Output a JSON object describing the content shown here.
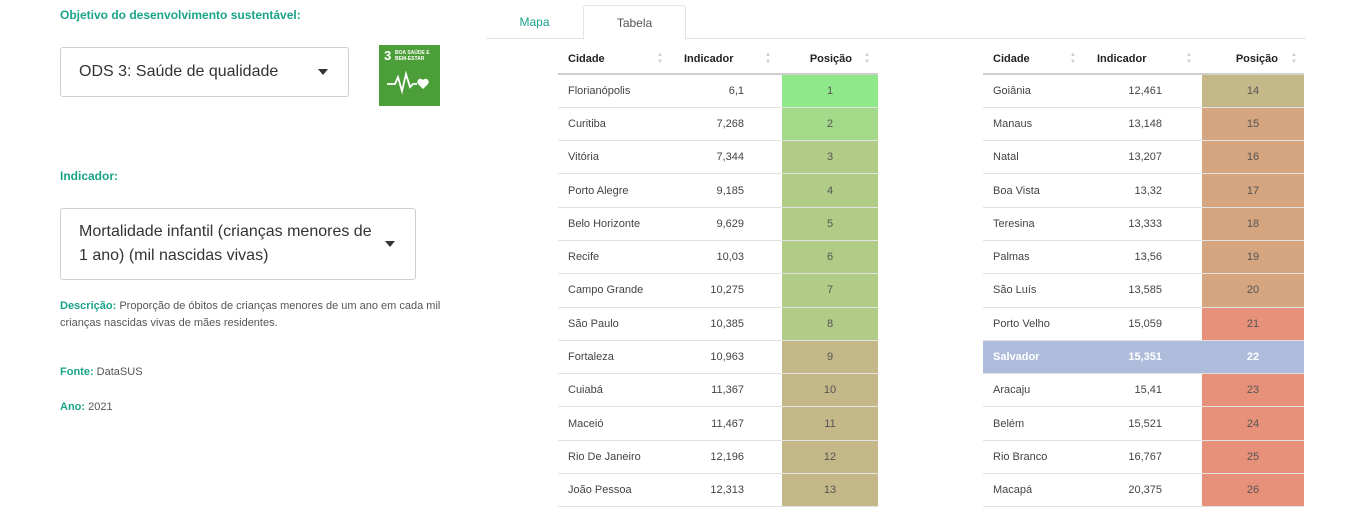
{
  "filters": {
    "ods_label": "Objetivo do desenvolvimento sustentável:",
    "ods_value": "ODS 3: Saúde de qualidade",
    "indicator_label": "Indicador:",
    "indicator_value": "Mortalidade infantil (crianças menores de 1 ano) (mil nascidas vivas)"
  },
  "sdg_logo": {
    "number": "3",
    "text": "BOA SAÚDE E BEM-ESTAR",
    "color": "#4c9f38",
    "icon": "heartbeat-icon"
  },
  "info": {
    "description_label": "Descrição:",
    "description": "Proporção de óbitos de crianças menores de um ano em cada mil crianças nascidas vivas de mães residentes.",
    "source_label": "Fonte:",
    "source": "DataSUS",
    "year_label": "Ano:",
    "year": "2021"
  },
  "tabs": {
    "map": "Mapa",
    "table": "Tabela",
    "active": "Tabela"
  },
  "columns": {
    "city": "Cidade",
    "indicator": "Indicador",
    "position": "Posição"
  },
  "highlight_color": "#aebcdc",
  "rows_left": [
    {
      "city": "Florianópolis",
      "indicator": "6,1",
      "position": "1",
      "color": "#8fe98a"
    },
    {
      "city": "Curitiba",
      "indicator": "7,268",
      "position": "2",
      "color": "#a3da8a"
    },
    {
      "city": "Vitória",
      "indicator": "7,344",
      "position": "3",
      "color": "#b0cc87"
    },
    {
      "city": "Porto Alegre",
      "indicator": "9,185",
      "position": "4",
      "color": "#b0cc87"
    },
    {
      "city": "Belo Horizonte",
      "indicator": "9,629",
      "position": "5",
      "color": "#b0cc87"
    },
    {
      "city": "Recife",
      "indicator": "10,03",
      "position": "6",
      "color": "#b0cc87"
    },
    {
      "city": "Campo Grande",
      "indicator": "10,275",
      "position": "7",
      "color": "#b0cc87"
    },
    {
      "city": "São Paulo",
      "indicator": "10,385",
      "position": "8",
      "color": "#b0cc87"
    },
    {
      "city": "Fortaleza",
      "indicator": "10,963",
      "position": "9",
      "color": "#c4b888"
    },
    {
      "city": "Cuiabá",
      "indicator": "11,367",
      "position": "10",
      "color": "#c4b888"
    },
    {
      "city": "Maceió",
      "indicator": "11,467",
      "position": "11",
      "color": "#c4b888"
    },
    {
      "city": "Rio De Janeiro",
      "indicator": "12,196",
      "position": "12",
      "color": "#c4b888"
    },
    {
      "city": "João Pessoa",
      "indicator": "12,313",
      "position": "13",
      "color": "#c4b888"
    }
  ],
  "rows_right": [
    {
      "city": "Goiânia",
      "indicator": "12,461",
      "position": "14",
      "color": "#c4b888"
    },
    {
      "city": "Manaus",
      "indicator": "13,148",
      "position": "15",
      "color": "#d4a57e"
    },
    {
      "city": "Natal",
      "indicator": "13,207",
      "position": "16",
      "color": "#d4a57e"
    },
    {
      "city": "Boa Vista",
      "indicator": "13,32",
      "position": "17",
      "color": "#d4a57e"
    },
    {
      "city": "Teresina",
      "indicator": "13,333",
      "position": "18",
      "color": "#d4a57e"
    },
    {
      "city": "Palmas",
      "indicator": "13,56",
      "position": "19",
      "color": "#d4a57e"
    },
    {
      "city": "São Luís",
      "indicator": "13,585",
      "position": "20",
      "color": "#d4a57e"
    },
    {
      "city": "Porto Velho",
      "indicator": "15,059",
      "position": "21",
      "color": "#e8917a"
    },
    {
      "city": "Salvador",
      "indicator": "15,351",
      "position": "22",
      "color": "#aebcdc",
      "highlighted": true
    },
    {
      "city": "Aracaju",
      "indicator": "15,41",
      "position": "23",
      "color": "#e8917a"
    },
    {
      "city": "Belém",
      "indicator": "15,521",
      "position": "24",
      "color": "#e8917a"
    },
    {
      "city": "Rio Branco",
      "indicator": "16,767",
      "position": "25",
      "color": "#e8917a"
    },
    {
      "city": "Macapá",
      "indicator": "20,375",
      "position": "26",
      "color": "#e8917a"
    }
  ]
}
